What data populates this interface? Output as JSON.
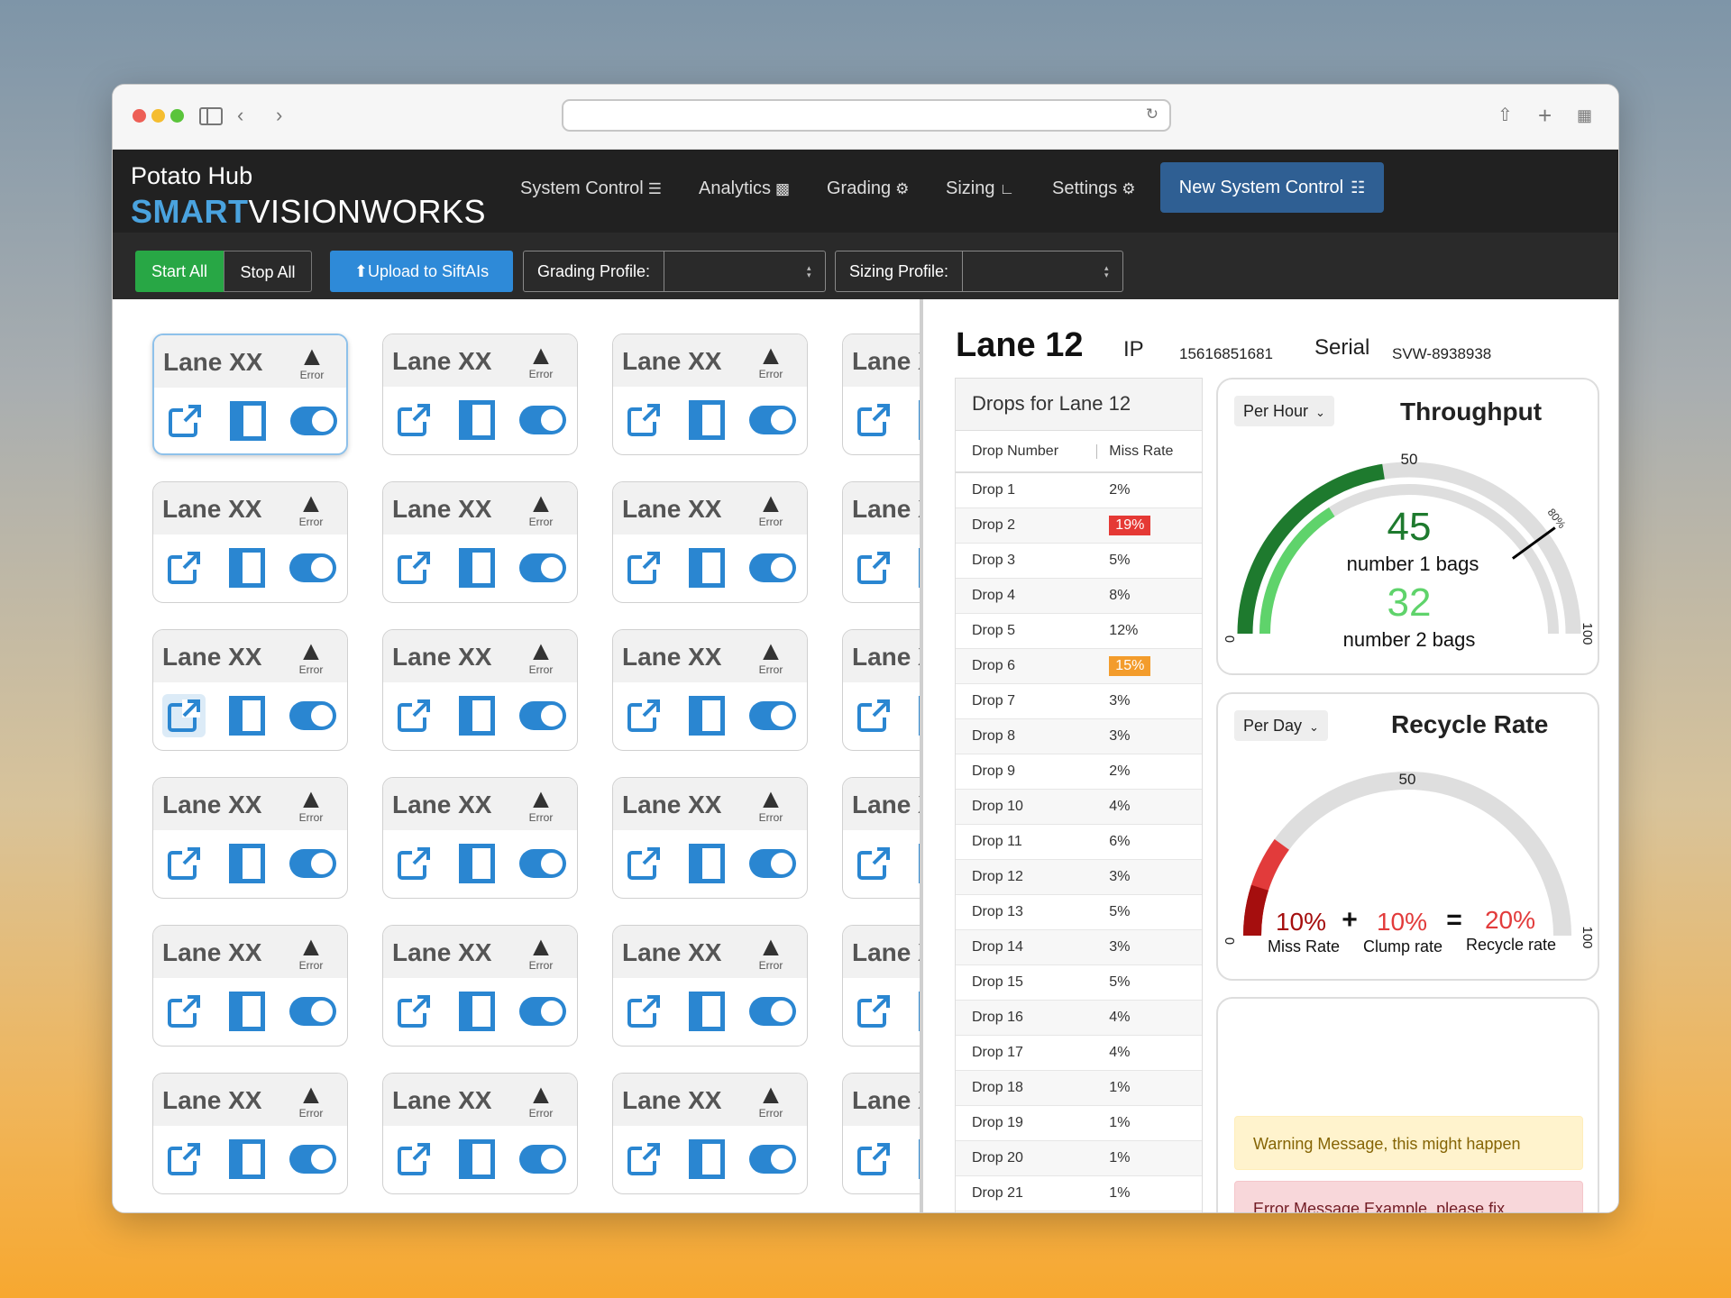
{
  "browser": {
    "url": ""
  },
  "header": {
    "app_title": "Potato Hub",
    "brand_bold": "SMART",
    "brand_rest": "VISIONWORKS",
    "nav": [
      {
        "label": "System Control",
        "icon": "sliders-icon"
      },
      {
        "label": "Analytics",
        "icon": "bar-chart-icon"
      },
      {
        "label": "Grading",
        "icon": "gear-icon"
      },
      {
        "label": "Sizing",
        "icon": "ruler-icon"
      },
      {
        "label": "Settings",
        "icon": "gears-icon"
      }
    ],
    "new_system_control": "New System Control"
  },
  "toolbar": {
    "start_all": "Start All",
    "stop_all": "Stop All",
    "upload": "Upload to SiftAIs",
    "grading_label": "Grading Profile:",
    "grading_value": "",
    "sizing_label": "Sizing Profile:",
    "sizing_value": ""
  },
  "lanes": {
    "title": "Lane XX",
    "status": "Error",
    "rows": 6,
    "cols": 4,
    "selected_index": 0,
    "highlighted_index": 8
  },
  "detail": {
    "lane_title": "Lane 12",
    "ip_label": "IP",
    "ip_value": "15616851681",
    "serial_label": "Serial",
    "serial_value": "SVW-8938938",
    "drops_title": "Drops for Lane 12",
    "col_drop": "Drop Number",
    "col_miss": "Miss Rate",
    "drops": [
      {
        "name": "Drop 1",
        "rate": "2%"
      },
      {
        "name": "Drop 2",
        "rate": "19%",
        "status": "danger"
      },
      {
        "name": "Drop 3",
        "rate": "5%"
      },
      {
        "name": "Drop 4",
        "rate": "8%"
      },
      {
        "name": "Drop 5",
        "rate": "12%"
      },
      {
        "name": "Drop 6",
        "rate": "15%",
        "status": "warning"
      },
      {
        "name": "Drop 7",
        "rate": "3%"
      },
      {
        "name": "Drop 8",
        "rate": "3%"
      },
      {
        "name": "Drop 9",
        "rate": "2%"
      },
      {
        "name": "Drop 10",
        "rate": "4%"
      },
      {
        "name": "Drop 11",
        "rate": "6%"
      },
      {
        "name": "Drop 12",
        "rate": "3%"
      },
      {
        "name": "Drop 13",
        "rate": "5%"
      },
      {
        "name": "Drop 14",
        "rate": "3%"
      },
      {
        "name": "Drop 15",
        "rate": "5%"
      },
      {
        "name": "Drop 16",
        "rate": "4%"
      },
      {
        "name": "Drop 17",
        "rate": "4%"
      },
      {
        "name": "Drop 18",
        "rate": "1%"
      },
      {
        "name": "Drop 19",
        "rate": "1%"
      },
      {
        "name": "Drop 20",
        "rate": "1%"
      },
      {
        "name": "Drop 21",
        "rate": "1%"
      }
    ],
    "throughput": {
      "period": "Per Hour",
      "title": "Throughput",
      "min": "0",
      "mid": "50",
      "max": "100",
      "marker_label": "80%",
      "marker_value": 80,
      "value1": "45",
      "label1": "number 1 bags",
      "value2": "32",
      "label2": "number 2 bags",
      "gauge1": 45,
      "gauge2": 32,
      "color1": "#1e7a2e",
      "color2": "#5fd36b"
    },
    "recycle": {
      "period": "Per Day",
      "title": "Recycle Rate",
      "min": "0",
      "mid": "50",
      "max": "100",
      "miss": "10%",
      "miss_label": "Miss Rate",
      "plus": "+",
      "clump": "10%",
      "clump_label": "Clump rate",
      "equals": "=",
      "total": "20%",
      "total_label": "Recycle rate",
      "gauge_miss": 10,
      "gauge_total": 20,
      "color_miss": "#a50e0e",
      "color_total": "#e23b3b"
    },
    "alerts": {
      "warning": "Warning Message, this might happen",
      "error": "Error Message Example, please fix"
    }
  },
  "colors": {
    "accent": "#2a86d1",
    "nav": "#212121",
    "start": "#28a745",
    "upload": "#2e8ad8"
  }
}
